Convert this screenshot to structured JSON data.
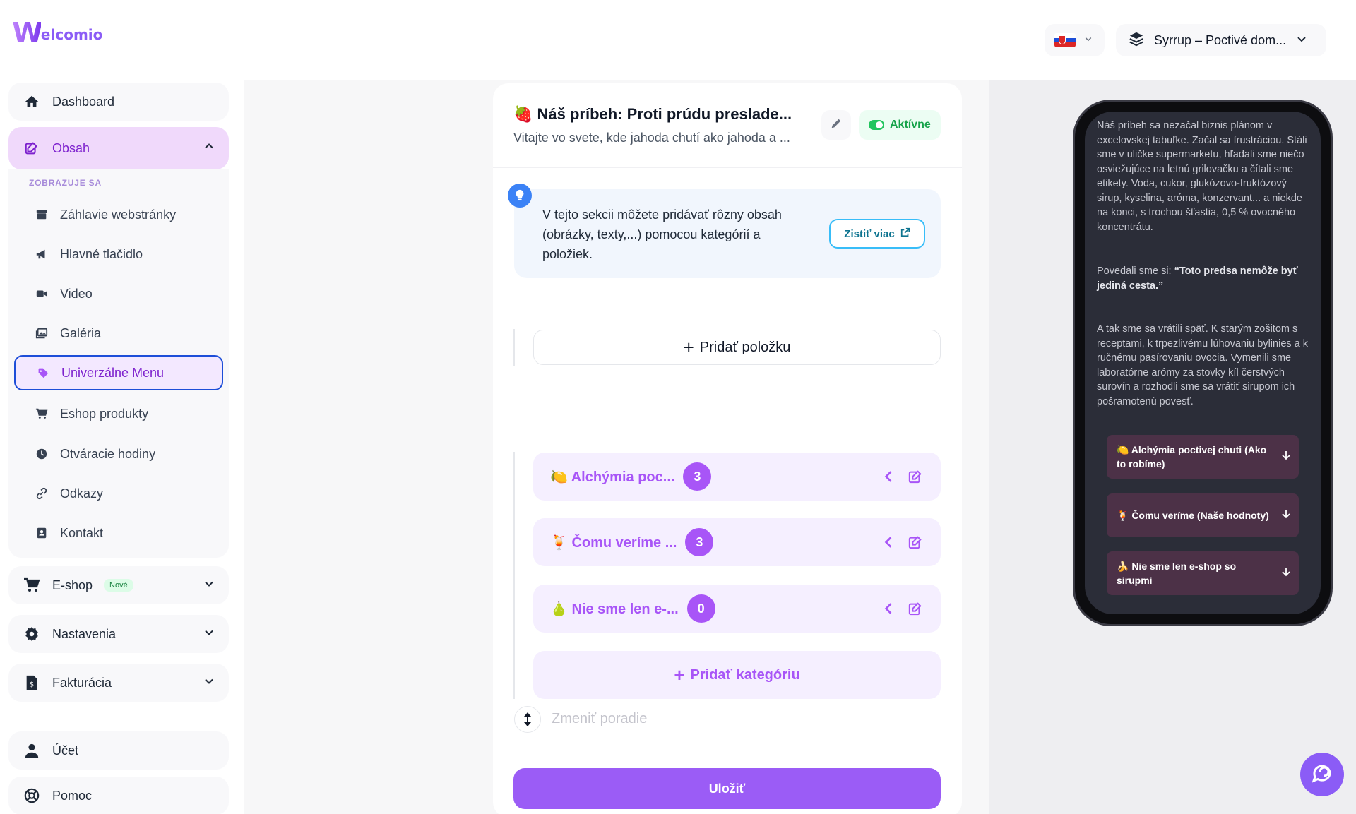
{
  "brand": {
    "logo_mark": "W",
    "logo_text": "elcomio"
  },
  "sidebar": {
    "dashboard": {
      "label": "Dashboard",
      "icon": "home-icon"
    },
    "content": {
      "label": "Obsah",
      "icon": "edit-icon"
    },
    "showing_caption": "ZOBRAZUJE SA",
    "content_items": [
      {
        "label": "Záhlavie webstránky",
        "icon": "store-icon"
      },
      {
        "label": "Hlavné tlačidlo",
        "icon": "megaphone-icon"
      },
      {
        "label": "Video",
        "icon": "video-icon"
      },
      {
        "label": "Galéria",
        "icon": "images-icon"
      },
      {
        "label": "Univerzálne Menu",
        "icon": "tag-icon"
      },
      {
        "label": "Eshop produkty",
        "icon": "cart-icon"
      },
      {
        "label": "Otváracie hodiny",
        "icon": "clock-icon"
      },
      {
        "label": "Odkazy",
        "icon": "link-icon"
      },
      {
        "label": "Kontakt",
        "icon": "contact-card-icon"
      }
    ],
    "eshop": {
      "label": "E-shop",
      "badge": "Nové",
      "icon": "cart-icon"
    },
    "settings": {
      "label": "Nastavenia",
      "icon": "gear-icon"
    },
    "billing": {
      "label": "Fakturácia",
      "icon": "invoice-icon"
    },
    "account": {
      "label": "Účet",
      "icon": "user-icon"
    },
    "help": {
      "label": "Pomoc",
      "icon": "lifebuoy-icon"
    }
  },
  "topbar": {
    "language_flag": "slovakia-flag-icon",
    "site_selector": "Syrrup – Poctivé dom..."
  },
  "editor": {
    "title": "🍓 Náš príbeh: Proti prúdu preslade...",
    "subtitle": "Vitajte vo svete, kde jahoda chutí ako jahoda a ...",
    "status": "Aktívne",
    "info_text": "V tejto sekcii môžete pridávať rôzny obsah (obrázky, texty,...) pomocou kategórií a položiek.",
    "info_button": "Zistiť viac",
    "add_item": "Pridať položku",
    "categories": [
      {
        "name": "🍋 Alchýmia poc...",
        "count": "3"
      },
      {
        "name": "🍹 Čomu veríme ...",
        "count": "3"
      },
      {
        "name": "🍐 Nie sme len e-...",
        "count": "0"
      }
    ],
    "add_category": "Pridať kategóriu",
    "reorder": "Zmeniť poradie",
    "save": "Uložiť"
  },
  "preview": {
    "p1": "Náš príbeh sa nezačal biznis plánom v excelovskej tabuľke. Začal sa frustráciou. Stáli sme v uličke supermarketu, hľadali sme niečo osviežujúce na letnú grilovačku a čítali sme etikety. Voda, cukor, glukózovo-fruktózový sirup, kyselina, aróma, konzervant... a niekde na konci, s trochou šťastia, 0,5 % ovocného koncentrátu.",
    "p2_prefix": "Povedali sme si: ",
    "p2_quote": "“Toto predsa nemôže byť jediná cesta.”",
    "p3": "A tak sme sa vrátili späť. K starým zošitom s receptami, k trpezlivému lúhovaniu bylinies a k ručnému pasírovaniu ovocia. Vymenili sme laboratórne arómy za stovky kíl čerstvých surovín a rozhodli sme sa vrátiť sirupom ich pošramotenú povesť.",
    "categories": [
      "🍋 Alchýmia poctivej chuti (Ako to robíme)",
      "🍹 Čomu veríme (Naše hodnoty)",
      "🍌 Nie sme len e-shop so sirupmi"
    ]
  },
  "colors": {
    "accent": "#a855f7",
    "save": "#9b5cf6",
    "active_green": "#16a34a"
  }
}
